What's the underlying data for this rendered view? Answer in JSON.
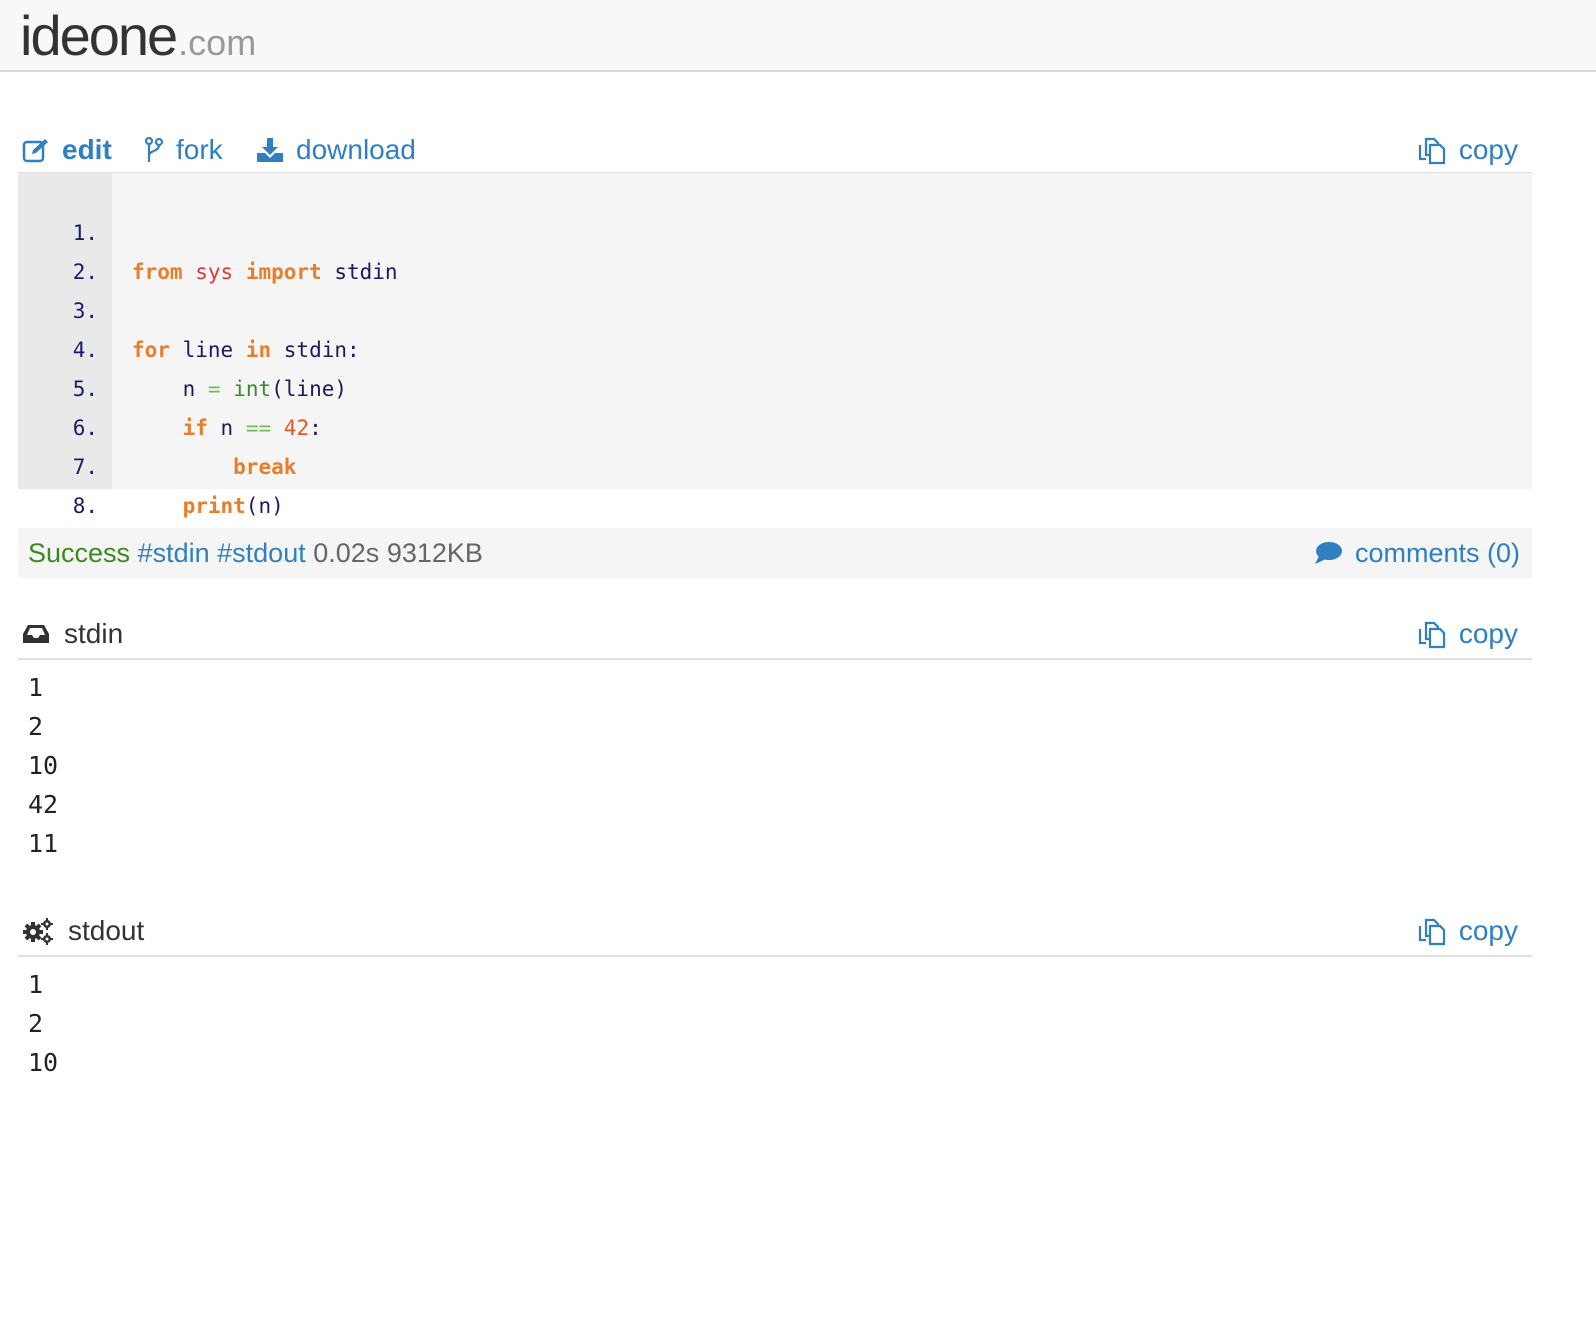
{
  "header": {
    "logo_main": "ideone",
    "logo_tld": ".com"
  },
  "toolbar": {
    "edit_label": "edit",
    "fork_label": "fork",
    "download_label": "download",
    "copy_label": "copy"
  },
  "code": {
    "line_numbers": [
      "1.",
      "2.",
      "3.",
      "4.",
      "5.",
      "6.",
      "7.",
      "8."
    ],
    "lines": [
      "from sys import stdin",
      "",
      "for line in stdin:",
      "    n = int(line)",
      "    if n == 42:",
      "        break",
      "    print(n)",
      ""
    ]
  },
  "status": {
    "result": "Success",
    "tags": [
      "#stdin",
      "#stdout"
    ],
    "time": "0.02s",
    "memory": "9312KB",
    "comments_label": "comments (0)"
  },
  "stdin": {
    "title": "stdin",
    "copy_label": "copy",
    "lines": [
      "1",
      "2",
      "10",
      "42",
      "11"
    ]
  },
  "stdout": {
    "title": "stdout",
    "copy_label": "copy",
    "lines": [
      "1",
      "2",
      "10"
    ]
  },
  "colors": {
    "link": "#2f7fc1",
    "success": "#3c8a1f",
    "keyword": "#e87d2a",
    "module": "#d63c3c",
    "builtin": "#3a8a2a",
    "number": "#e8552a"
  },
  "icons": {
    "edit": "edit-icon",
    "fork": "fork-icon",
    "download": "download-icon",
    "copy": "copy-icon",
    "comments": "comment-icon",
    "stdin": "inbox-icon",
    "stdout": "gears-icon"
  }
}
